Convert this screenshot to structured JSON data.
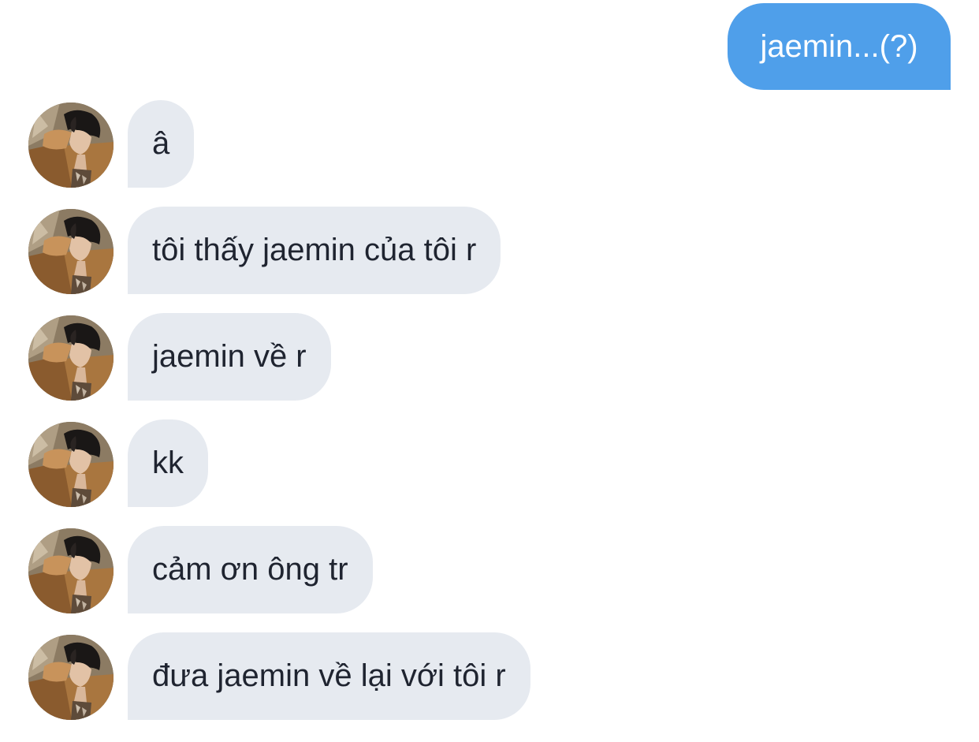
{
  "chat": {
    "outgoing": [
      {
        "text": "jaemin...(?)"
      }
    ],
    "incoming": [
      {
        "text": "â"
      },
      {
        "text": "tôi thấy jaemin của tôi r"
      },
      {
        "text": "jaemin về r"
      },
      {
        "text": "kk"
      },
      {
        "text": "cảm ơn ông tr"
      },
      {
        "text": "đưa jaemin về lại với tôi r"
      }
    ]
  },
  "colors": {
    "outgoing_bubble": "#4f9fea",
    "incoming_bubble": "#e6eaf0",
    "incoming_text": "#1f2430",
    "background": "#ffffff"
  },
  "icons": {
    "avatar": "contact-avatar-photo"
  }
}
